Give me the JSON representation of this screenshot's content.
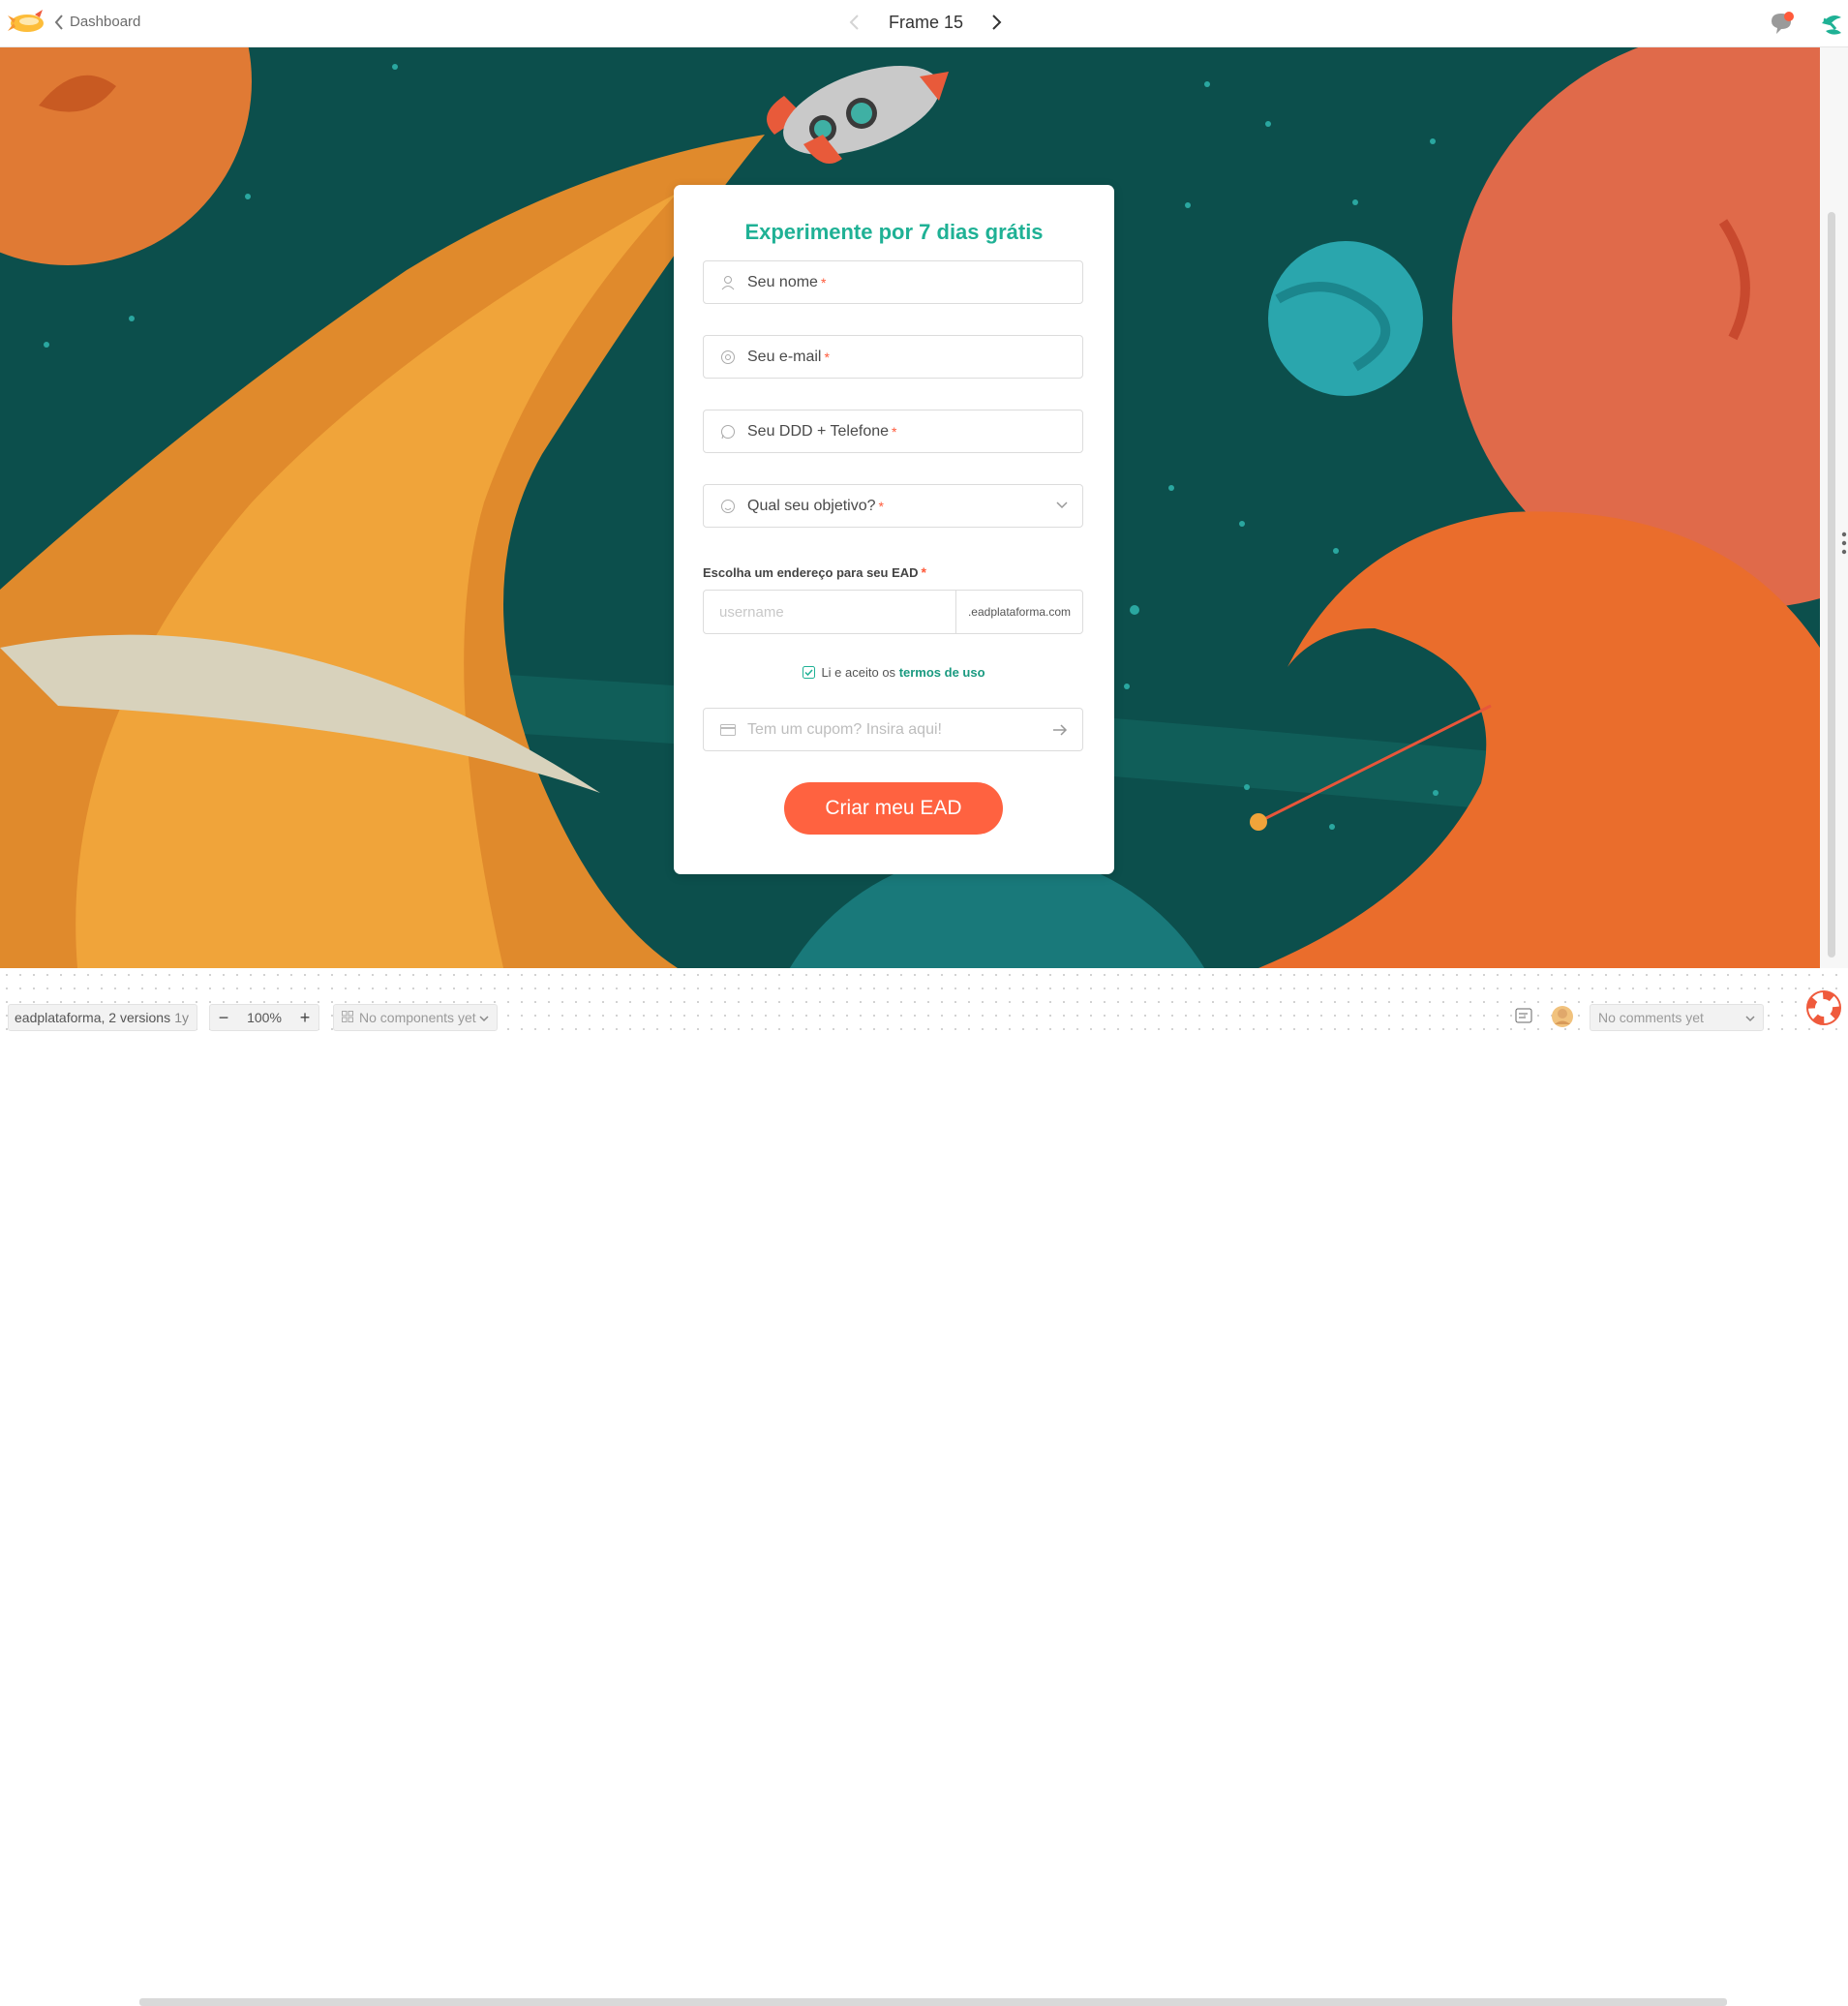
{
  "topbar": {
    "back_label": "Dashboard",
    "frame_title": "Frame 15"
  },
  "form": {
    "title": "Experimente por 7 dias grátis",
    "fields": [
      {
        "label": "Seu nome",
        "icon": "user-icon",
        "required": "*"
      },
      {
        "label": "Seu e-mail",
        "icon": "at-sign-icon",
        "required": "*"
      },
      {
        "label": "Seu DDD + Telefone",
        "icon": "whatsapp-icon",
        "required": "*"
      },
      {
        "label": "Qual seu objetivo?",
        "icon": "smiley-icon",
        "required": "*"
      }
    ],
    "address_label": "Escolha um endereço para seu EAD",
    "address_required": "*",
    "username_placeholder": "username",
    "domain_suffix": ".eadplataforma.com",
    "terms_text": "Li e aceito os",
    "terms_link": "termos de uso",
    "coupon_placeholder": "Tem um cupom? Insira aqui!",
    "submit_label": "Criar meu EAD"
  },
  "bottombar": {
    "versions_label": "eadplataforma, 2 versions",
    "versions_age": "1y",
    "zoom_level": "100%",
    "zoom_minus": "−",
    "zoom_plus": "+",
    "components_label": "No components yet",
    "comments_label": "No comments yet"
  },
  "colors": {
    "accent": "#1fb195",
    "button": "#ff6240",
    "required": "#ff5a3a",
    "space_bg": "#0c4f4c"
  }
}
